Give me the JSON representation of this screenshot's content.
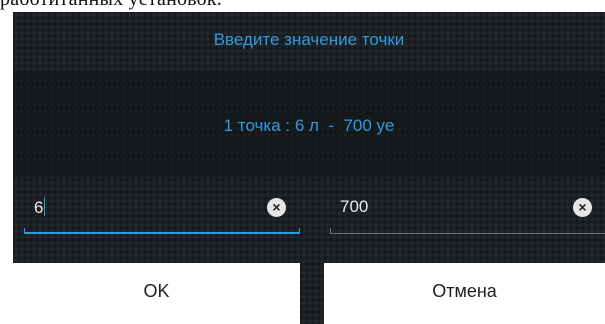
{
  "document_caption": "работитанных установок.",
  "dialog": {
    "title": "Введите значение точки",
    "point_summary": "1 точка : 6 л  -  700 уе"
  },
  "fields": {
    "volume": {
      "value": "6",
      "focused": true
    },
    "amount": {
      "value": "700",
      "focused": false
    }
  },
  "buttons": {
    "ok_label": "OK",
    "cancel_label": "Отмена"
  },
  "icons": {
    "clear": "clear-circle-icon"
  },
  "colors": {
    "accent": "#2f9be0",
    "dialog_bg": "#1c2024",
    "field_text": "#e9ecef",
    "button_bg": "#ffffff"
  }
}
